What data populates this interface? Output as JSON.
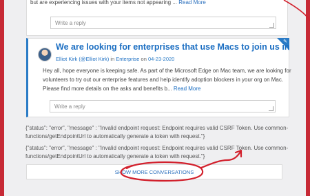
{
  "top_card": {
    "truncated_text": "but are experiencing issues with your items not appearing ...",
    "read_more": "Read More",
    "reply_placeholder": "Write a reply"
  },
  "post": {
    "title": "We are looking for enterprises that use Macs to join us in making Micro...",
    "author": "Elliot Kirk (@Elliot Kirk)",
    "in_label": "in",
    "board": "Enterprise",
    "on_label": "on",
    "date": "04-23-2020",
    "body_lines": [
      "Hey all, hope everyone is keeping safe. As part of the Microsoft Edge on Mac team, we are looking for",
      "volunteers to try out our enterprise features and help identify adoption blockers in your org on Mac.",
      "Please find more details on the asks and benefits b..."
    ],
    "read_more": "Read More",
    "reply_placeholder": "Write a reply"
  },
  "errors": [
    {
      "line1": "{\"status\": \"error\", \"message\" : \"Invalid endpoint request: Endpoint requires valid CSRF Token. Use common-",
      "line2": "functions/getEndpointUrl to automatically generate a token with request.\"}"
    },
    {
      "line1": "{\"status\": \"error\", \"message\" : \"Invalid endpoint request: Endpoint requires valid CSRF Token. Use common-",
      "line2": "functions/getEndpointUrl to automatically generate a token with request.\"}"
    }
  ],
  "show_more_label": "SHOW MORE CONVERSATIONS",
  "colors": {
    "accent": "#1b6ec2",
    "annotation": "#d2202c",
    "frame": "#c72a36"
  }
}
